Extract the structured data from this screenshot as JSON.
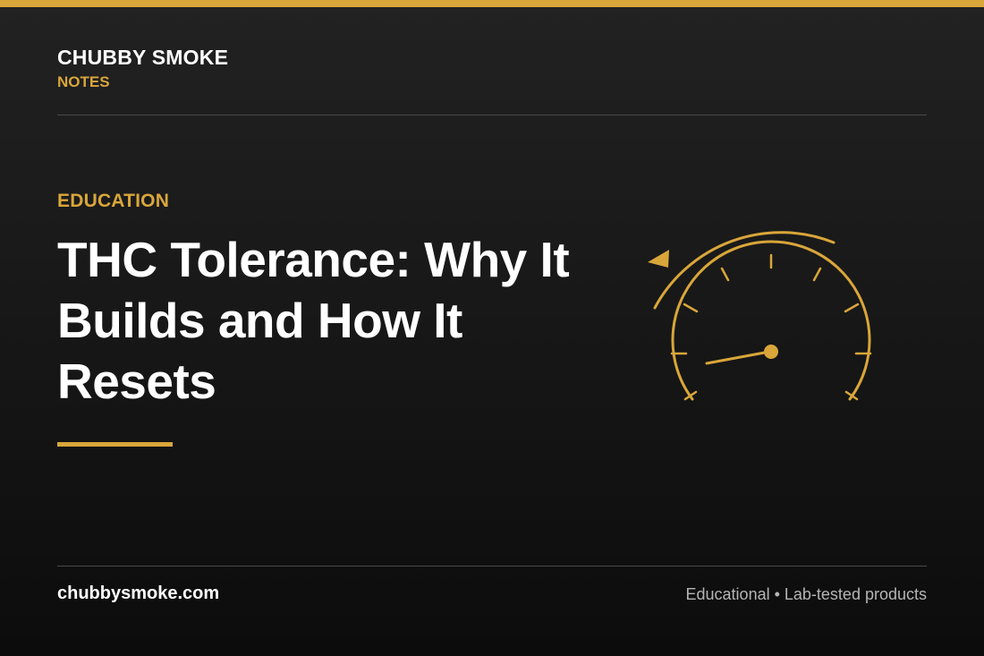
{
  "brand": {
    "name": "CHUBBY SMOKE",
    "sub": "NOTES"
  },
  "article": {
    "category": "EDUCATION",
    "title": "THC Tolerance: Why It Builds and How It Resets"
  },
  "footer": {
    "site": "chubbysmoke.com",
    "tagline": "Educational • Lab-tested products"
  },
  "icons": {
    "gauge": "speedometer-gauge-icon",
    "arrow": "counterclockwise-arrow-icon"
  },
  "colors": {
    "accent": "#d9a63a",
    "background": "#161616",
    "text": "#ffffff",
    "muted": "#b5b5b5"
  }
}
